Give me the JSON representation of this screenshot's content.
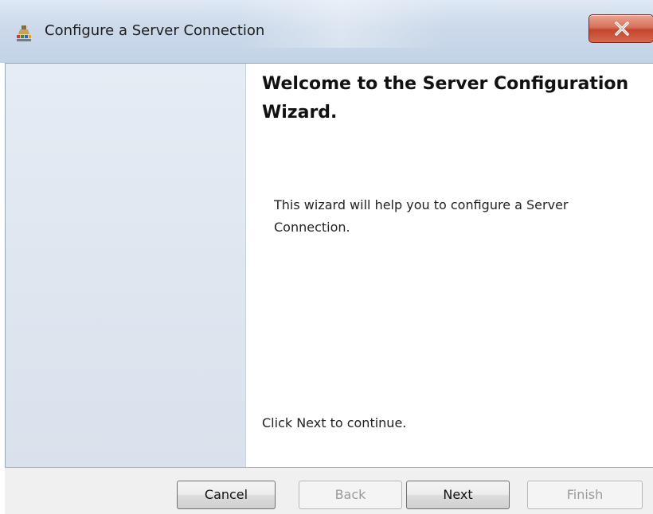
{
  "window": {
    "title": "Configure a Server Connection"
  },
  "content": {
    "welcome_title": "Welcome to the Server Configuration Wizard.",
    "description": "This wizard will help you to configure a Server Connection.",
    "continue_text": "Click Next to continue."
  },
  "buttons": {
    "cancel": "Cancel",
    "back": "Back",
    "next": "Next",
    "finish": "Finish"
  },
  "state": {
    "back_enabled": false,
    "finish_enabled": false
  },
  "icons": {
    "app": "server-connection-icon",
    "close": "close-icon"
  }
}
